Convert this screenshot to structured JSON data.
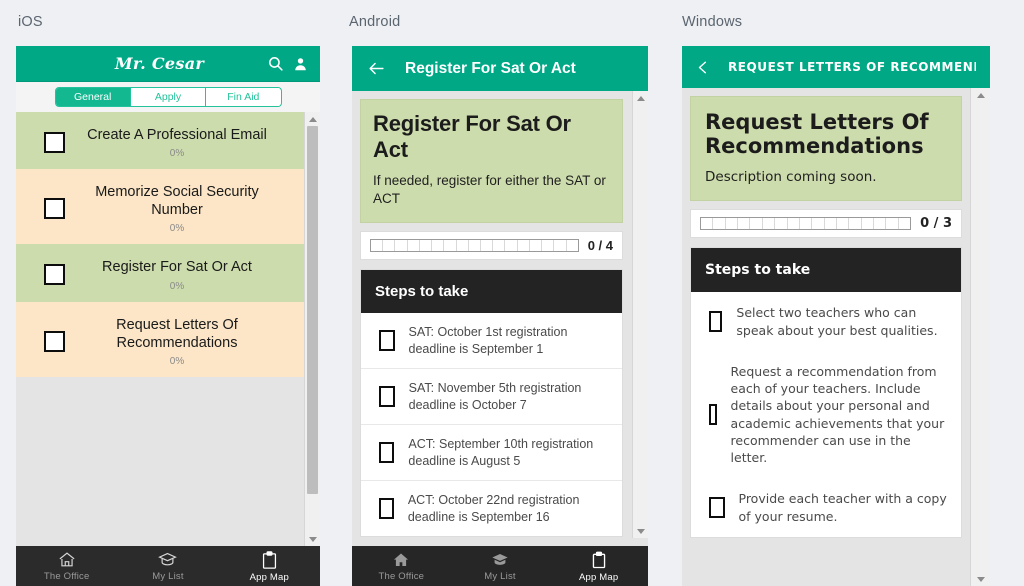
{
  "columns": {
    "ios_label": "iOS",
    "android_label": "Android",
    "windows_label": "Windows"
  },
  "colors": {
    "brand_teal": "#00a886",
    "segment_teal": "#14b890",
    "card_green": "#cddcad",
    "card_peach": "#fce6c7",
    "steps_header": "#232323",
    "navbar": "#2b2b2b",
    "page_bg": "#eef0f3"
  },
  "ios": {
    "header": {
      "title": "Mr. Cesar",
      "search_icon": "search-icon",
      "profile_icon": "person-icon"
    },
    "tabs": [
      {
        "label": "General",
        "active": true
      },
      {
        "label": "Apply",
        "active": false
      },
      {
        "label": "Fin Aid",
        "active": false
      }
    ],
    "list": [
      {
        "title": "Create A Professional Email",
        "progress": "0%",
        "tone": "green"
      },
      {
        "title": "Memorize Social Security Number",
        "progress": "0%",
        "tone": "peach"
      },
      {
        "title": "Register For Sat Or Act",
        "progress": "0%",
        "tone": "green"
      },
      {
        "title": "Request Letters Of Recommendations",
        "progress": "0%",
        "tone": "peach"
      }
    ],
    "navbar": [
      {
        "label": "The Office",
        "icon": "home-icon",
        "state": "dim"
      },
      {
        "label": "My List",
        "icon": "graduation-cap-icon",
        "state": "dim"
      },
      {
        "label": "App Map",
        "icon": "clipboard-icon",
        "state": "active"
      }
    ]
  },
  "android": {
    "header": {
      "back_icon": "arrow-left-icon",
      "title": "Register For Sat Or Act"
    },
    "hero": {
      "title": "Register For Sat Or Act",
      "description": "If needed, register for either the SAT or ACT"
    },
    "progress": {
      "count": "0 / 4",
      "segments": 17,
      "filled": 0
    },
    "steps_header": "Steps to take",
    "steps": [
      "SAT: October 1st registration deadline is September 1",
      "SAT: November 5th registration deadline is October 7",
      "ACT: September 10th registration deadline is August 5",
      "ACT: October 22nd registration deadline is September 16"
    ],
    "navbar": [
      {
        "label": "The Office",
        "icon": "home-icon",
        "state": "dim"
      },
      {
        "label": "My List",
        "icon": "graduation-cap-icon",
        "state": "dim"
      },
      {
        "label": "App Map",
        "icon": "clipboard-icon",
        "state": "active"
      }
    ]
  },
  "windows": {
    "header": {
      "back_icon": "chevron-left-icon",
      "title": "REQUEST LETTERS OF RECOMMENDA..."
    },
    "hero": {
      "title": "Request Letters Of Recommendations",
      "description": "Description coming soon."
    },
    "progress": {
      "count": "0 / 3",
      "segments": 17,
      "filled": 0
    },
    "steps_header": "Steps to take",
    "steps": [
      "Select two teachers who can speak about your best qualities.",
      "Request a recommendation from each of your teachers. Include details about your personal and academic achievements that your recommender can use in the letter.",
      "Provide each teacher with a copy of your resume."
    ]
  }
}
